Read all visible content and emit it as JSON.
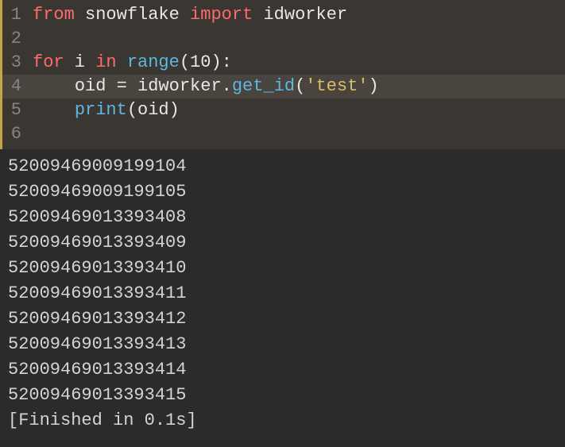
{
  "code": {
    "lines": [
      {
        "num": "1",
        "highlighted": false
      },
      {
        "num": "2",
        "highlighted": false
      },
      {
        "num": "3",
        "highlighted": false
      },
      {
        "num": "4",
        "highlighted": true
      },
      {
        "num": "5",
        "highlighted": false
      },
      {
        "num": "6",
        "highlighted": false
      }
    ],
    "line1": {
      "from": "from",
      "module": " snowflake ",
      "import": "import",
      "name": " idworker"
    },
    "line3": {
      "for": "for",
      "var": " i ",
      "in": "in",
      "func": " range",
      "args": "(",
      "num": "10",
      "close": "):"
    },
    "line4": {
      "indent": "    ",
      "var": "oid ",
      "eq": "= ",
      "obj": "idworker",
      "dot": ".",
      "method": "get_id",
      "open": "(",
      "str": "'test'",
      "close": ")"
    },
    "line5": {
      "indent": "    ",
      "func": "print",
      "open": "(",
      "arg": "oid",
      "close": ")"
    }
  },
  "output": {
    "lines": [
      "52009469009199104",
      "52009469009199105",
      "52009469013393408",
      "52009469013393409",
      "52009469013393410",
      "52009469013393411",
      "52009469013393412",
      "52009469013393413",
      "52009469013393414",
      "52009469013393415"
    ],
    "status": "[Finished in 0.1s]"
  }
}
